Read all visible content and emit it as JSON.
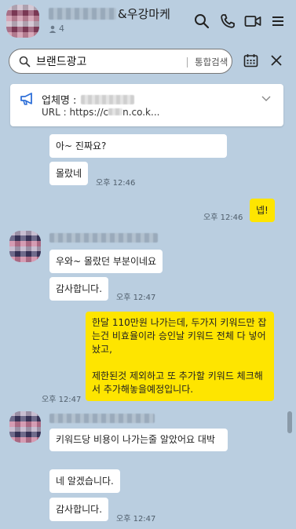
{
  "header": {
    "title_suffix": "&우강마케",
    "member_count": "4"
  },
  "search": {
    "query": "브랜드광고",
    "all_search_label": "통합검색"
  },
  "notice": {
    "company_label": "업체명 :",
    "url_label": "URL : https://c",
    "url_suffix": "n.co.k..."
  },
  "messages": [
    {
      "side": "other",
      "text": "아~ 진짜요?"
    },
    {
      "side": "other",
      "text": "몰랐네",
      "time": "오후 12:46"
    },
    {
      "side": "me",
      "text": "넵!",
      "time": "오후 12:46"
    },
    {
      "side": "other",
      "text": "우와~ 몰랐던 부분이네요"
    },
    {
      "side": "other",
      "text": "감사합니다.",
      "time": "오후 12:47"
    },
    {
      "side": "me",
      "text_line1": "한달 110만원 나가는데, 두가지 키워드만 잡는건 비효율이라 승인날 키워드 전체 다 넣어놨고,",
      "text_line2": "제한된것 제외하고 또 추가할 키워드 체크해서 추가해놓을예정입니다.",
      "time": "오후 12:47"
    },
    {
      "side": "other",
      "text": "키워드당 비용이 나가는줄 알았어요 대박"
    },
    {
      "side": "other",
      "text": "네 알겠습니다."
    },
    {
      "side": "other",
      "text": "감사합니다.",
      "time": "오후 12:47"
    }
  ],
  "colors": {
    "background": "#bacee0",
    "my_bubble": "#fee500",
    "other_bubble": "#ffffff"
  }
}
